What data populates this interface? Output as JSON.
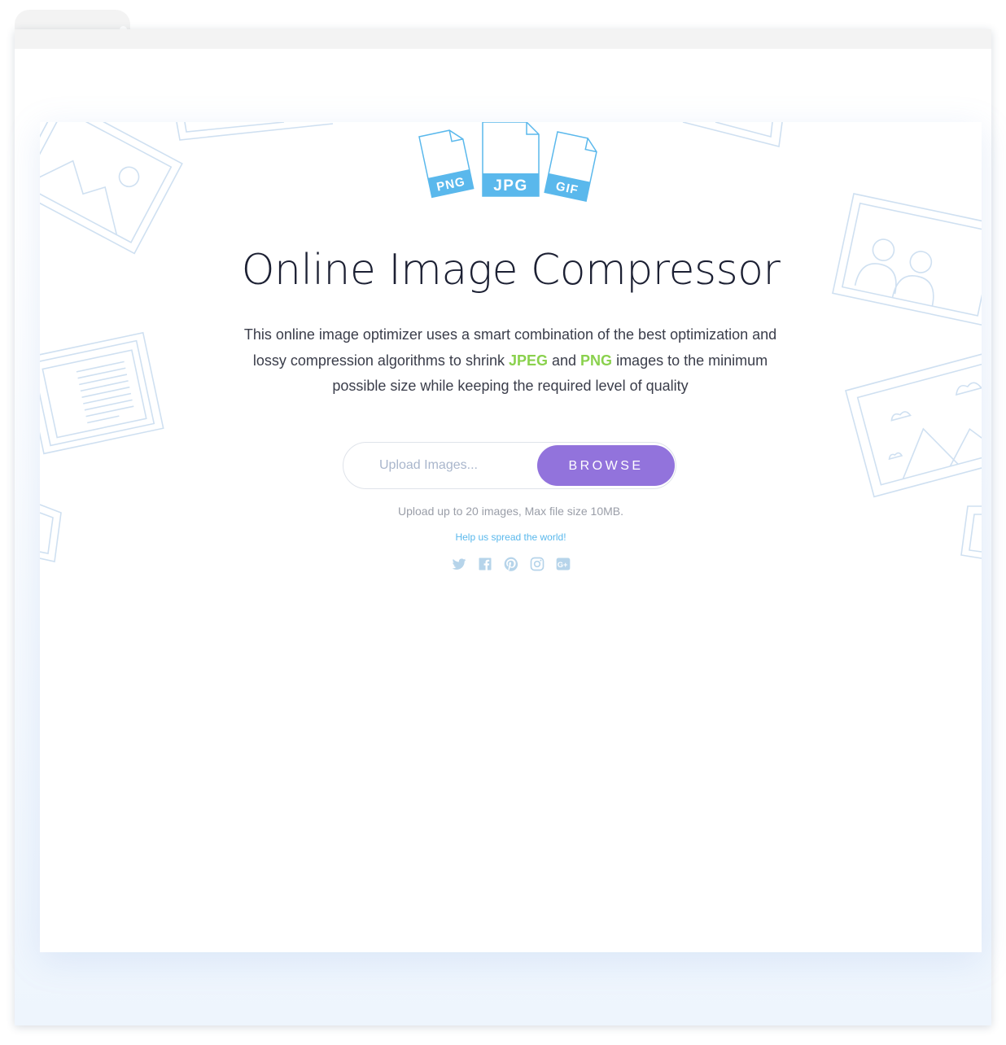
{
  "title": "Online Image Compressor",
  "description": {
    "part1": "This online image optimizer uses a smart combination of the best optimization and lossy compression algorithms to shrink ",
    "highlight1": "JPEG",
    "part2": " and ",
    "highlight2": "PNG",
    "part3": " images to the minimum possible size while keeping the required level of quality"
  },
  "file_types": [
    "PNG",
    "JPG",
    "GIF"
  ],
  "upload": {
    "placeholder": "Upload Images...",
    "browse_label": "BROWSE",
    "limit_text": "Upload up to 20 images, Max file size 10MB."
  },
  "share": {
    "label": "Help us spread the world!",
    "icons": [
      "twitter-icon",
      "facebook-icon",
      "pinterest-icon",
      "instagram-icon",
      "google-plus-icon"
    ]
  },
  "colors": {
    "accent": "#9273dc",
    "highlight": "#8ad14d",
    "link": "#5ab8ec",
    "icon": "#b6d4ea",
    "file_icon": "#5ab8ec"
  }
}
